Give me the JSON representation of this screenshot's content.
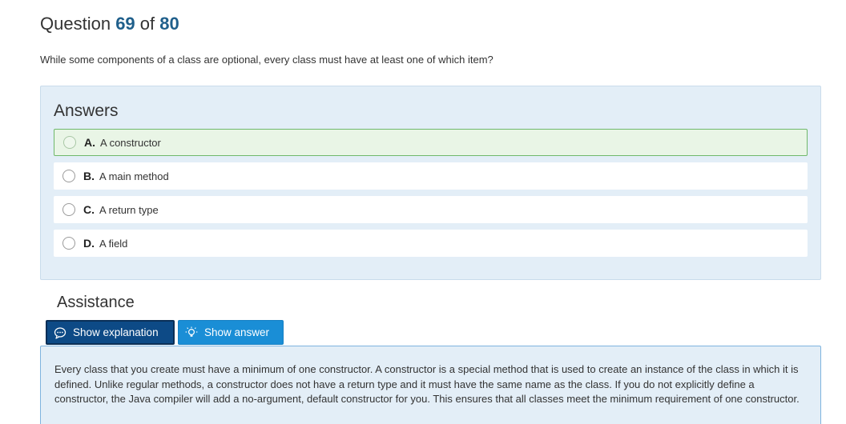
{
  "question": {
    "label": "Question",
    "number": "69",
    "of_label": "of",
    "total": "80",
    "text": "While some components of a class are optional, every class must have at least one of which item?"
  },
  "answers": {
    "heading": "Answers",
    "options": [
      {
        "letter": "A.",
        "text": "A constructor",
        "selected": true
      },
      {
        "letter": "B.",
        "text": "A main method",
        "selected": false
      },
      {
        "letter": "C.",
        "text": "A return type",
        "selected": false
      },
      {
        "letter": "D.",
        "text": "A field",
        "selected": false
      }
    ]
  },
  "assistance": {
    "heading": "Assistance",
    "show_explanation_label": "Show explanation",
    "show_explanation_icon": "chat-bubble-icon",
    "show_answer_label": "Show answer",
    "show_answer_icon": "lightbulb-icon"
  },
  "explanation": {
    "text": "Every class that you create must have a minimum of one constructor. A constructor is a special method that is used to create an instance of the class in which it is defined. Unlike regular methods, a constructor does not have a return type and it must have the same name as the class. If you do not explicitly define a constructor, the Java compiler will add a no-argument, default constructor for you. This ensures that all classes meet the minimum requirement of one constructor."
  },
  "colors": {
    "accent_dark": "#0d4a86",
    "accent_light": "#1a8ed6",
    "panel_bg": "#e3eef7",
    "selected_border": "#6fb86a",
    "question_number": "#1f5f8b"
  }
}
